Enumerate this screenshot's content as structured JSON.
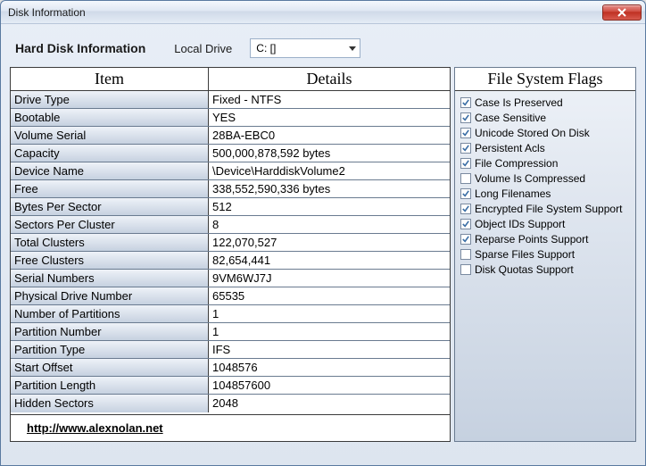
{
  "window": {
    "title": "Disk Information"
  },
  "topbar": {
    "hd_label": "Hard Disk Information",
    "local_drive_label": "Local Drive",
    "selected_drive": "C: []"
  },
  "headers": {
    "item": "Item",
    "details": "Details",
    "flags": "File System Flags"
  },
  "rows": [
    {
      "item": "Drive Type",
      "details": "Fixed - NTFS"
    },
    {
      "item": "Bootable",
      "details": "YES"
    },
    {
      "item": "Volume Serial",
      "details": "28BA-EBC0"
    },
    {
      "item": "Capacity",
      "details": "500,000,878,592 bytes"
    },
    {
      "item": "Device Name",
      "details": "\\Device\\HarddiskVolume2"
    },
    {
      "item": "Free",
      "details": "338,552,590,336 bytes"
    },
    {
      "item": "Bytes Per Sector",
      "details": "512"
    },
    {
      "item": "Sectors Per Cluster",
      "details": "8"
    },
    {
      "item": "Total Clusters",
      "details": "122,070,527"
    },
    {
      "item": "Free Clusters",
      "details": "82,654,441"
    },
    {
      "item": "Serial Numbers",
      "details": "9VM6WJ7J"
    },
    {
      "item": "Physical Drive Number",
      "details": "65535"
    },
    {
      "item": "Number of Partitions",
      "details": "1"
    },
    {
      "item": "Partition Number",
      "details": "1"
    },
    {
      "item": "Partition Type",
      "details": "IFS"
    },
    {
      "item": "Start Offset",
      "details": "1048576"
    },
    {
      "item": "Partition Length",
      "details": "104857600"
    },
    {
      "item": "Hidden Sectors",
      "details": "2048"
    }
  ],
  "flags": [
    {
      "label": "Case Is Preserved",
      "checked": true
    },
    {
      "label": "Case Sensitive",
      "checked": true
    },
    {
      "label": "Unicode Stored On Disk",
      "checked": true
    },
    {
      "label": "Persistent Acls",
      "checked": true
    },
    {
      "label": "File Compression",
      "checked": true
    },
    {
      "label": "Volume Is Compressed",
      "checked": false
    },
    {
      "label": "Long Filenames",
      "checked": true
    },
    {
      "label": "Encrypted File System Support",
      "checked": true
    },
    {
      "label": "Object IDs Support",
      "checked": true
    },
    {
      "label": "Reparse Points Support",
      "checked": true
    },
    {
      "label": "Sparse Files Support",
      "checked": false
    },
    {
      "label": "Disk Quotas Support",
      "checked": false
    }
  ],
  "footer": {
    "url_text": "http://www.alexnolan.net"
  }
}
